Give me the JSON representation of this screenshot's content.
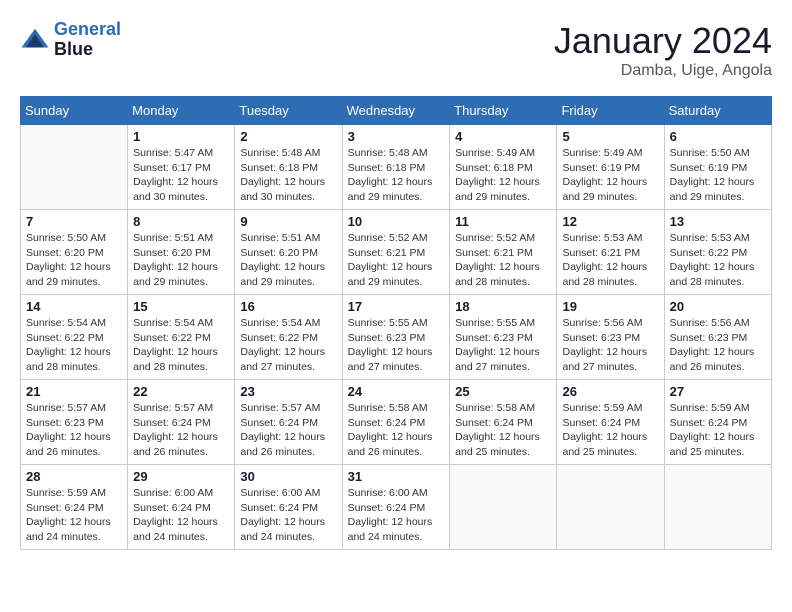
{
  "logo": {
    "line1": "General",
    "line2": "Blue"
  },
  "title": "January 2024",
  "location": "Damba, Uige, Angola",
  "weekdays": [
    "Sunday",
    "Monday",
    "Tuesday",
    "Wednesday",
    "Thursday",
    "Friday",
    "Saturday"
  ],
  "weeks": [
    [
      {
        "day": "",
        "info": ""
      },
      {
        "day": "1",
        "info": "Sunrise: 5:47 AM\nSunset: 6:17 PM\nDaylight: 12 hours\nand 30 minutes."
      },
      {
        "day": "2",
        "info": "Sunrise: 5:48 AM\nSunset: 6:18 PM\nDaylight: 12 hours\nand 30 minutes."
      },
      {
        "day": "3",
        "info": "Sunrise: 5:48 AM\nSunset: 6:18 PM\nDaylight: 12 hours\nand 29 minutes."
      },
      {
        "day": "4",
        "info": "Sunrise: 5:49 AM\nSunset: 6:18 PM\nDaylight: 12 hours\nand 29 minutes."
      },
      {
        "day": "5",
        "info": "Sunrise: 5:49 AM\nSunset: 6:19 PM\nDaylight: 12 hours\nand 29 minutes."
      },
      {
        "day": "6",
        "info": "Sunrise: 5:50 AM\nSunset: 6:19 PM\nDaylight: 12 hours\nand 29 minutes."
      }
    ],
    [
      {
        "day": "7",
        "info": "Sunrise: 5:50 AM\nSunset: 6:20 PM\nDaylight: 12 hours\nand 29 minutes."
      },
      {
        "day": "8",
        "info": "Sunrise: 5:51 AM\nSunset: 6:20 PM\nDaylight: 12 hours\nand 29 minutes."
      },
      {
        "day": "9",
        "info": "Sunrise: 5:51 AM\nSunset: 6:20 PM\nDaylight: 12 hours\nand 29 minutes."
      },
      {
        "day": "10",
        "info": "Sunrise: 5:52 AM\nSunset: 6:21 PM\nDaylight: 12 hours\nand 29 minutes."
      },
      {
        "day": "11",
        "info": "Sunrise: 5:52 AM\nSunset: 6:21 PM\nDaylight: 12 hours\nand 28 minutes."
      },
      {
        "day": "12",
        "info": "Sunrise: 5:53 AM\nSunset: 6:21 PM\nDaylight: 12 hours\nand 28 minutes."
      },
      {
        "day": "13",
        "info": "Sunrise: 5:53 AM\nSunset: 6:22 PM\nDaylight: 12 hours\nand 28 minutes."
      }
    ],
    [
      {
        "day": "14",
        "info": "Sunrise: 5:54 AM\nSunset: 6:22 PM\nDaylight: 12 hours\nand 28 minutes."
      },
      {
        "day": "15",
        "info": "Sunrise: 5:54 AM\nSunset: 6:22 PM\nDaylight: 12 hours\nand 28 minutes."
      },
      {
        "day": "16",
        "info": "Sunrise: 5:54 AM\nSunset: 6:22 PM\nDaylight: 12 hours\nand 27 minutes."
      },
      {
        "day": "17",
        "info": "Sunrise: 5:55 AM\nSunset: 6:23 PM\nDaylight: 12 hours\nand 27 minutes."
      },
      {
        "day": "18",
        "info": "Sunrise: 5:55 AM\nSunset: 6:23 PM\nDaylight: 12 hours\nand 27 minutes."
      },
      {
        "day": "19",
        "info": "Sunrise: 5:56 AM\nSunset: 6:23 PM\nDaylight: 12 hours\nand 27 minutes."
      },
      {
        "day": "20",
        "info": "Sunrise: 5:56 AM\nSunset: 6:23 PM\nDaylight: 12 hours\nand 26 minutes."
      }
    ],
    [
      {
        "day": "21",
        "info": "Sunrise: 5:57 AM\nSunset: 6:23 PM\nDaylight: 12 hours\nand 26 minutes."
      },
      {
        "day": "22",
        "info": "Sunrise: 5:57 AM\nSunset: 6:24 PM\nDaylight: 12 hours\nand 26 minutes."
      },
      {
        "day": "23",
        "info": "Sunrise: 5:57 AM\nSunset: 6:24 PM\nDaylight: 12 hours\nand 26 minutes."
      },
      {
        "day": "24",
        "info": "Sunrise: 5:58 AM\nSunset: 6:24 PM\nDaylight: 12 hours\nand 26 minutes."
      },
      {
        "day": "25",
        "info": "Sunrise: 5:58 AM\nSunset: 6:24 PM\nDaylight: 12 hours\nand 25 minutes."
      },
      {
        "day": "26",
        "info": "Sunrise: 5:59 AM\nSunset: 6:24 PM\nDaylight: 12 hours\nand 25 minutes."
      },
      {
        "day": "27",
        "info": "Sunrise: 5:59 AM\nSunset: 6:24 PM\nDaylight: 12 hours\nand 25 minutes."
      }
    ],
    [
      {
        "day": "28",
        "info": "Sunrise: 5:59 AM\nSunset: 6:24 PM\nDaylight: 12 hours\nand 24 minutes."
      },
      {
        "day": "29",
        "info": "Sunrise: 6:00 AM\nSunset: 6:24 PM\nDaylight: 12 hours\nand 24 minutes."
      },
      {
        "day": "30",
        "info": "Sunrise: 6:00 AM\nSunset: 6:24 PM\nDaylight: 12 hours\nand 24 minutes."
      },
      {
        "day": "31",
        "info": "Sunrise: 6:00 AM\nSunset: 6:24 PM\nDaylight: 12 hours\nand 24 minutes."
      },
      {
        "day": "",
        "info": ""
      },
      {
        "day": "",
        "info": ""
      },
      {
        "day": "",
        "info": ""
      }
    ]
  ]
}
